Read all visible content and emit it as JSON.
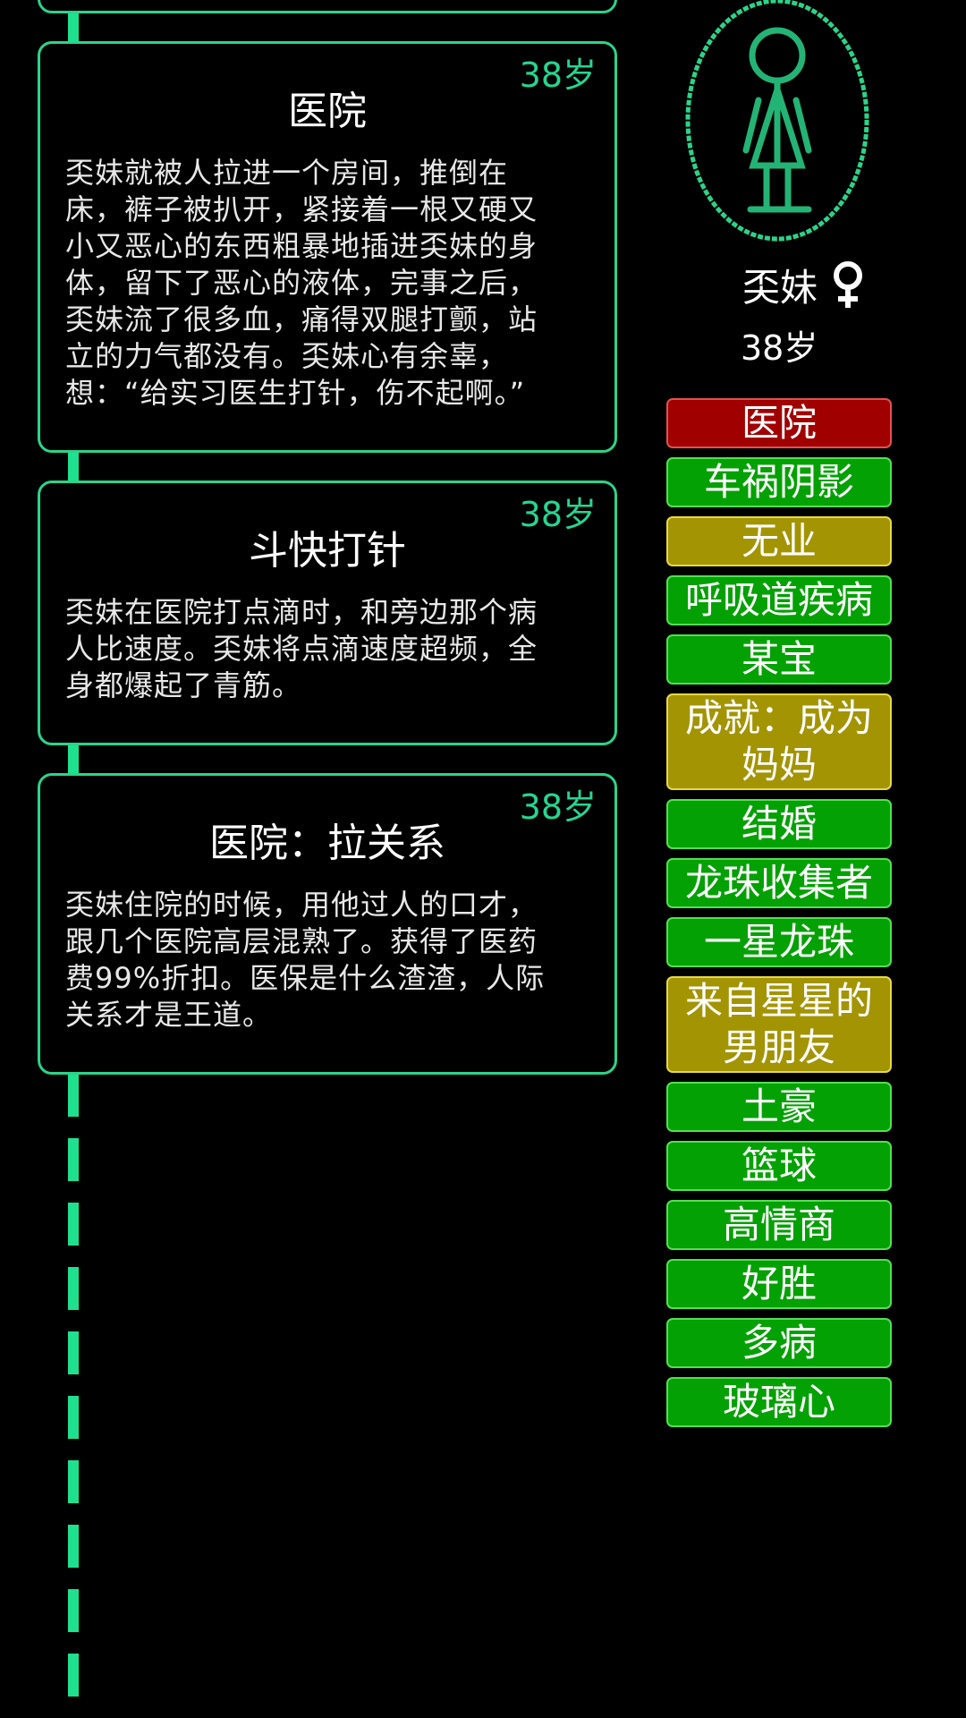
{
  "events": [
    {
      "age": "38岁",
      "title": "医院",
      "body": "奀妹就被人拉进一个房间，推倒在床，裤子被扒开，紧接着一根又硬又小又恶心的东西粗暴地插进奀妹的身体，留下了恶心的液体，完事之后，奀妹流了很多血，痛得双腿打颤，站立的力气都没有。奀妹心有余辜，想：“给实习医生打针，伤不起啊。”"
    },
    {
      "age": "38岁",
      "title": "斗快打针",
      "body": "奀妹在医院打点滴时，和旁边那个病人比速度。奀妹将点滴速度超频，全身都爆起了青筋。"
    },
    {
      "age": "38岁",
      "title": "医院：拉关系",
      "body": "奀妹住院的时候，用他过人的口才，跟几个医院高层混熟了。获得了医药费99%折扣。医保是什么渣渣，人际关系才是王道。"
    }
  ],
  "player": {
    "name": "奀妹",
    "gender_icon": "female-symbol-icon",
    "age": "38岁",
    "portrait": "stick-figure-portrait"
  },
  "tags": [
    {
      "label": "医院",
      "color": "#a10000",
      "kind": "red"
    },
    {
      "label": "车祸阴影",
      "color": "#04a104",
      "kind": "green"
    },
    {
      "label": "无业",
      "color": "#a39404",
      "kind": "gold"
    },
    {
      "label": "呼吸道疾病",
      "color": "#04a104",
      "kind": "green"
    },
    {
      "label": "某宝",
      "color": "#04a104",
      "kind": "green"
    },
    {
      "label": "成就：成为妈妈",
      "color": "#a39404",
      "kind": "gold"
    },
    {
      "label": "结婚",
      "color": "#04a104",
      "kind": "green"
    },
    {
      "label": "龙珠收集者",
      "color": "#04a104",
      "kind": "green"
    },
    {
      "label": "一星龙珠",
      "color": "#04a104",
      "kind": "green"
    },
    {
      "label": "来自星星的男朋友",
      "color": "#a39404",
      "kind": "gold"
    },
    {
      "label": "土豪",
      "color": "#04a104",
      "kind": "green"
    },
    {
      "label": "篮球",
      "color": "#04a104",
      "kind": "green"
    },
    {
      "label": "高情商",
      "color": "#04a104",
      "kind": "green"
    },
    {
      "label": "好胜",
      "color": "#04a104",
      "kind": "green"
    },
    {
      "label": "多病",
      "color": "#04a104",
      "kind": "green"
    },
    {
      "label": "玻璃心",
      "color": "#04a104",
      "kind": "green"
    }
  ],
  "colors": {
    "accent": "#1fe08f",
    "background": "#000000"
  }
}
